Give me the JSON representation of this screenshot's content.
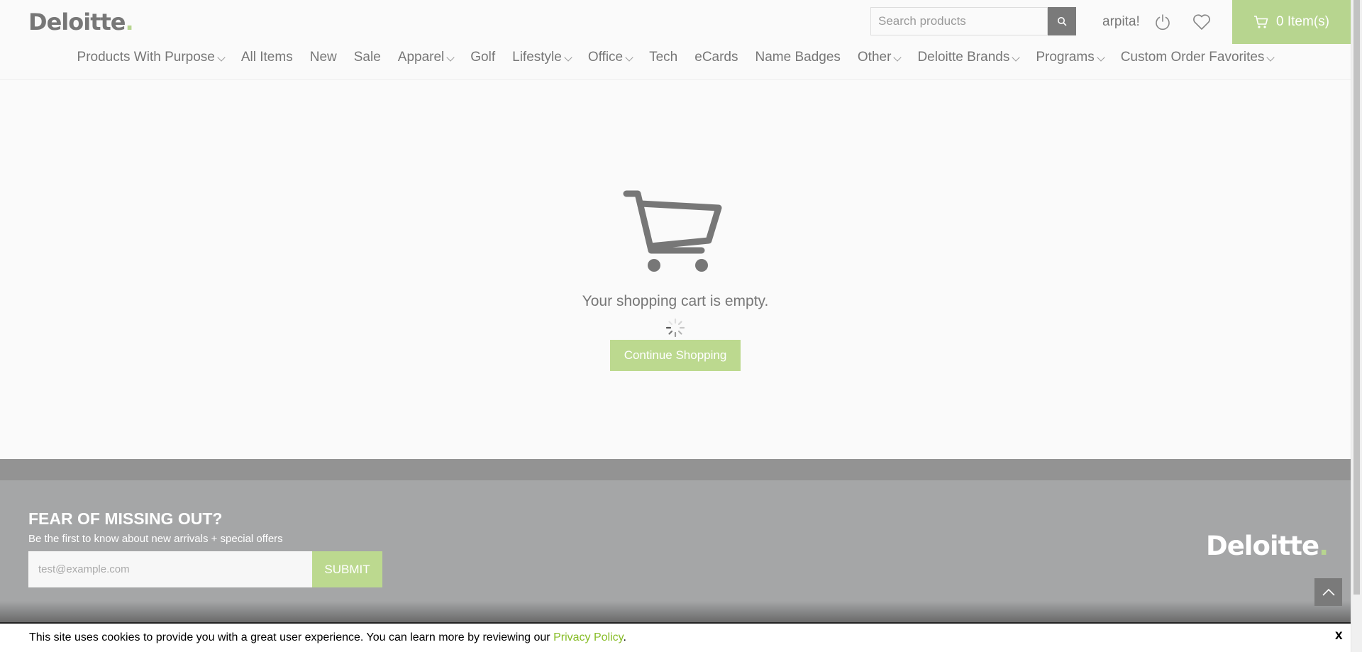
{
  "header": {
    "logo_text": "Deloitte",
    "logo_dot": ".",
    "search_placeholder": "Search products",
    "user_name": "arpita!",
    "cart_label": "0 Item(s)"
  },
  "nav": [
    {
      "label": "Products With Purpose",
      "dropdown": true
    },
    {
      "label": "All Items",
      "dropdown": false
    },
    {
      "label": "New",
      "dropdown": false
    },
    {
      "label": "Sale",
      "dropdown": false
    },
    {
      "label": "Apparel",
      "dropdown": true
    },
    {
      "label": "Golf",
      "dropdown": false
    },
    {
      "label": "Lifestyle",
      "dropdown": true
    },
    {
      "label": "Office",
      "dropdown": true
    },
    {
      "label": "Tech",
      "dropdown": false
    },
    {
      "label": "eCards",
      "dropdown": false
    },
    {
      "label": "Name Badges",
      "dropdown": false
    },
    {
      "label": "Other",
      "dropdown": true
    },
    {
      "label": "Deloitte Brands",
      "dropdown": true
    },
    {
      "label": "Programs",
      "dropdown": true
    },
    {
      "label": "Custom Order Favorites",
      "dropdown": true
    }
  ],
  "main": {
    "empty_message": "Your shopping cart is empty.",
    "continue_label": "Continue Shopping"
  },
  "footer": {
    "title": "FEAR OF MISSING OUT?",
    "subtitle": "Be the first to know about new arrivals + special offers",
    "email_placeholder": "test@example.com",
    "submit_label": "SUBMIT",
    "logo_text": "Deloitte",
    "logo_dot": "."
  },
  "cookie": {
    "text": "This site uses cookies to provide you with a great user experience. You can learn more by reviewing our ",
    "link": "Privacy Policy",
    "after": ".",
    "close": "x"
  },
  "colors": {
    "accent": "#b7d58f",
    "footer_bg": "#a5a6a7",
    "text_gray": "#777777"
  }
}
